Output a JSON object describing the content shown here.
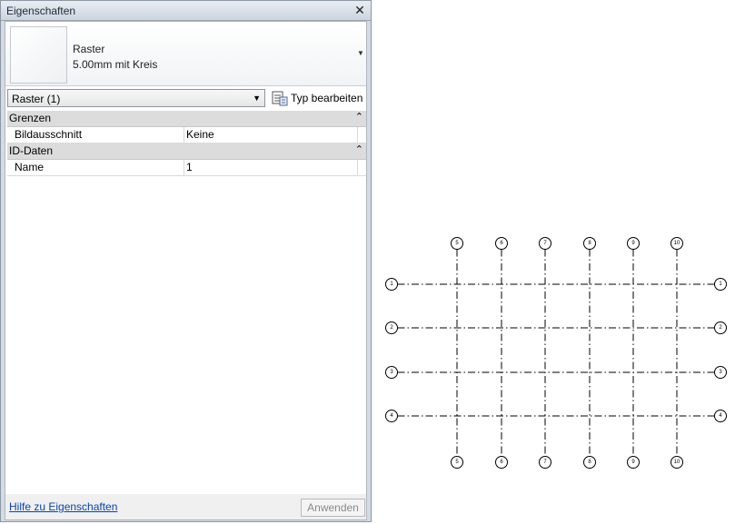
{
  "palette": {
    "title": "Eigenschaften",
    "close_icon": "close-icon",
    "type_selector": {
      "family": "Raster",
      "type": "5.00mm mit Kreis"
    },
    "filter": {
      "selected": "Raster (1)"
    },
    "edit_type_label": "Typ bearbeiten",
    "groups": [
      {
        "label": "Grenzen",
        "properties": [
          {
            "name": "Bildausschnitt",
            "value": "Keine"
          }
        ]
      },
      {
        "label": "ID-Daten",
        "properties": [
          {
            "name": "Name",
            "value": "1"
          }
        ]
      }
    ],
    "help_link": "Hilfe zu Eigenschaften",
    "apply_label": "Anwenden"
  },
  "grid": {
    "vertical_labels": [
      "5",
      "6",
      "7",
      "8",
      "9",
      "10"
    ],
    "horizontal_labels": [
      "1",
      "2",
      "3",
      "4"
    ]
  }
}
